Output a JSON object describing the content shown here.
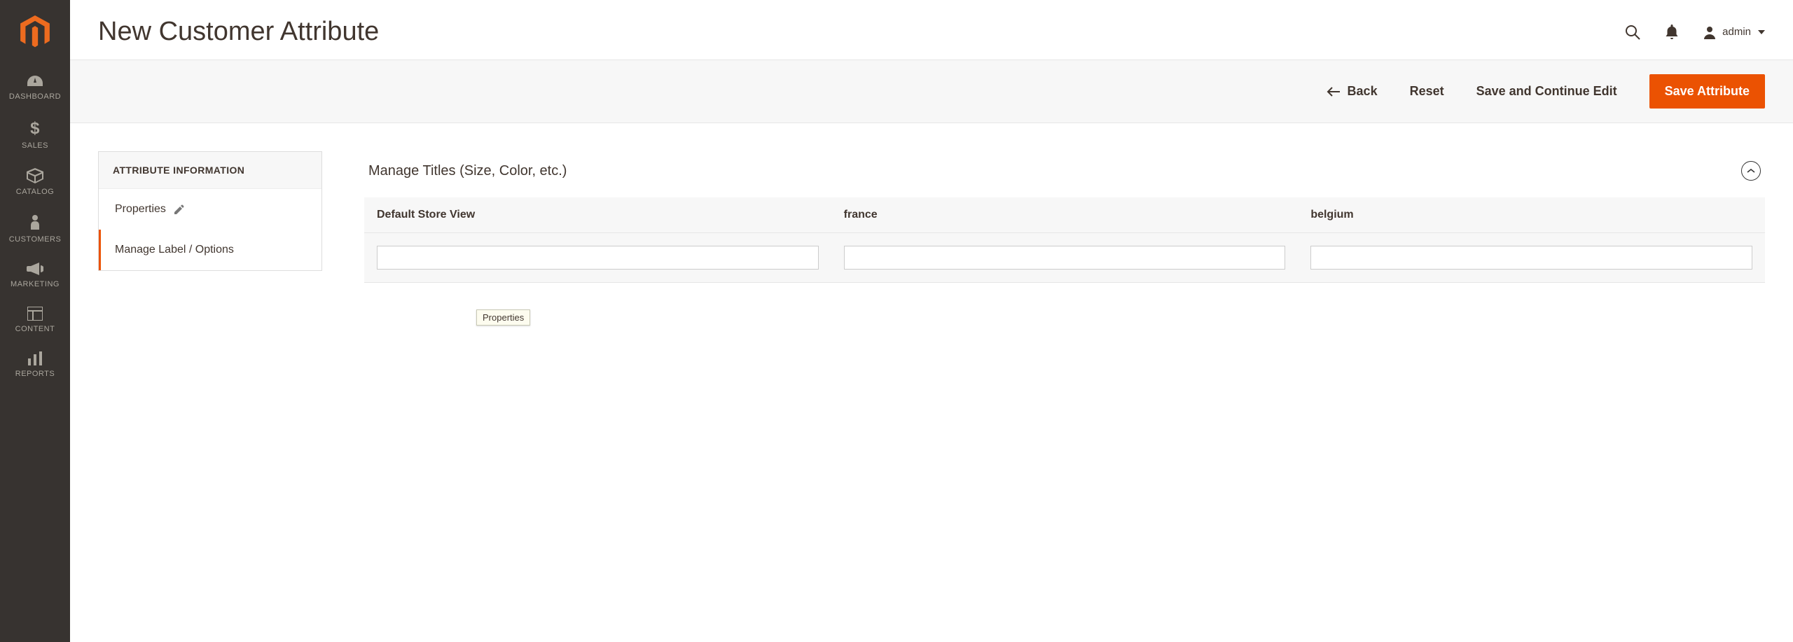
{
  "colors": {
    "accent": "#eb5202",
    "sidebar_bg": "#373330"
  },
  "sidebar": {
    "items": [
      {
        "label": "DASHBOARD"
      },
      {
        "label": "SALES"
      },
      {
        "label": "CATALOG"
      },
      {
        "label": "CUSTOMERS"
      },
      {
        "label": "MARKETING"
      },
      {
        "label": "CONTENT"
      },
      {
        "label": "REPORTS"
      }
    ]
  },
  "header": {
    "title": "New Customer Attribute",
    "user": "admin"
  },
  "actions": {
    "back": "Back",
    "reset": "Reset",
    "save_continue": "Save and Continue Edit",
    "save": "Save Attribute"
  },
  "attr_panel": {
    "title": "ATTRIBUTE INFORMATION",
    "tabs": [
      {
        "label": "Properties"
      },
      {
        "label": "Manage Label / Options"
      }
    ],
    "active_index": 1,
    "tooltip": "Properties"
  },
  "section": {
    "title": "Manage Titles (Size, Color, etc.)",
    "columns": [
      {
        "label": "Default Store View",
        "value": ""
      },
      {
        "label": "france",
        "value": ""
      },
      {
        "label": "belgium",
        "value": ""
      }
    ]
  }
}
